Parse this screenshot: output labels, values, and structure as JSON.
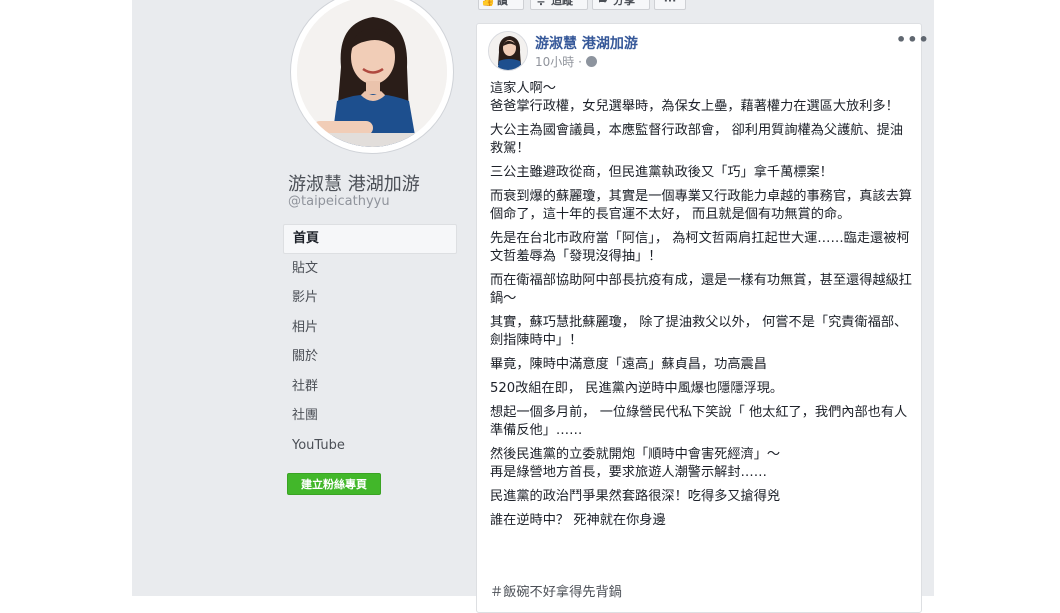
{
  "action_bar": {
    "like_label": "讚",
    "follow_label": "追蹤",
    "share_label": "分享",
    "more_label": "···"
  },
  "profile": {
    "name": "游淑慧 港湖加游",
    "handle": "@taipeicathyyu"
  },
  "nav": {
    "items": [
      {
        "label": "首頁",
        "active": true
      },
      {
        "label": "貼文"
      },
      {
        "label": "影片"
      },
      {
        "label": "相片"
      },
      {
        "label": "關於"
      },
      {
        "label": "社群"
      },
      {
        "label": "社團"
      },
      {
        "label": "YouTube"
      }
    ],
    "create_page_label": "建立粉絲專頁"
  },
  "post": {
    "author": "游淑慧 港湖加游",
    "time": "10小時",
    "more_label": "•••",
    "paragraphs": [
      "這家人啊～\n爸爸掌行政權，女兒選舉時，為保女上壘，藉著權力在選區大放利多！",
      "大公主為國會議員，本應監督行政部會，  卻利用質詢權為父護航、提油救駕！",
      "三公主雖避政從商，但民進黨執政後又「巧」拿千萬標案！",
      "而衰到爆的蘇麗瓊，其實是一個專業又行政能力卓越的事務官，真該去算個命了，這十年的長官運不太好，  而且就是個有功無賞的命。",
      "先是在台北市政府當「阿信」，  為柯文哲兩肩扛起世大運……臨走還被柯文哲羞辱為「發現沒得抽」！",
      "而在衛福部協助阿中部長抗疫有成，還是一樣有功無賞，甚至還得越級扛鍋～",
      "其實，蘇巧慧批蘇麗瓊，  除了提油救父以外，  何嘗不是「究責衛福部、劍指陳時中」！",
      "畢竟，陳時中滿意度「遠高」蘇貞昌，功高震昌",
      "520改組在即，  民進黨內逆時中風爆也隱隱浮現。",
      "想起一個多月前，  一位綠營民代私下笑說「 他太紅了，我們內部也有人準備反他」……",
      "然後民進黨的立委就開炮「順時中會害死經濟」～\n再是綠營地方首長，要求旅遊人潮警示解封……",
      "民進黨的政治鬥爭果然套路很深！吃得多又搶得兇",
      "誰在逆時中？  死神就在你身邊"
    ],
    "hashtag": "＃飯碗不好拿得先背鍋"
  }
}
